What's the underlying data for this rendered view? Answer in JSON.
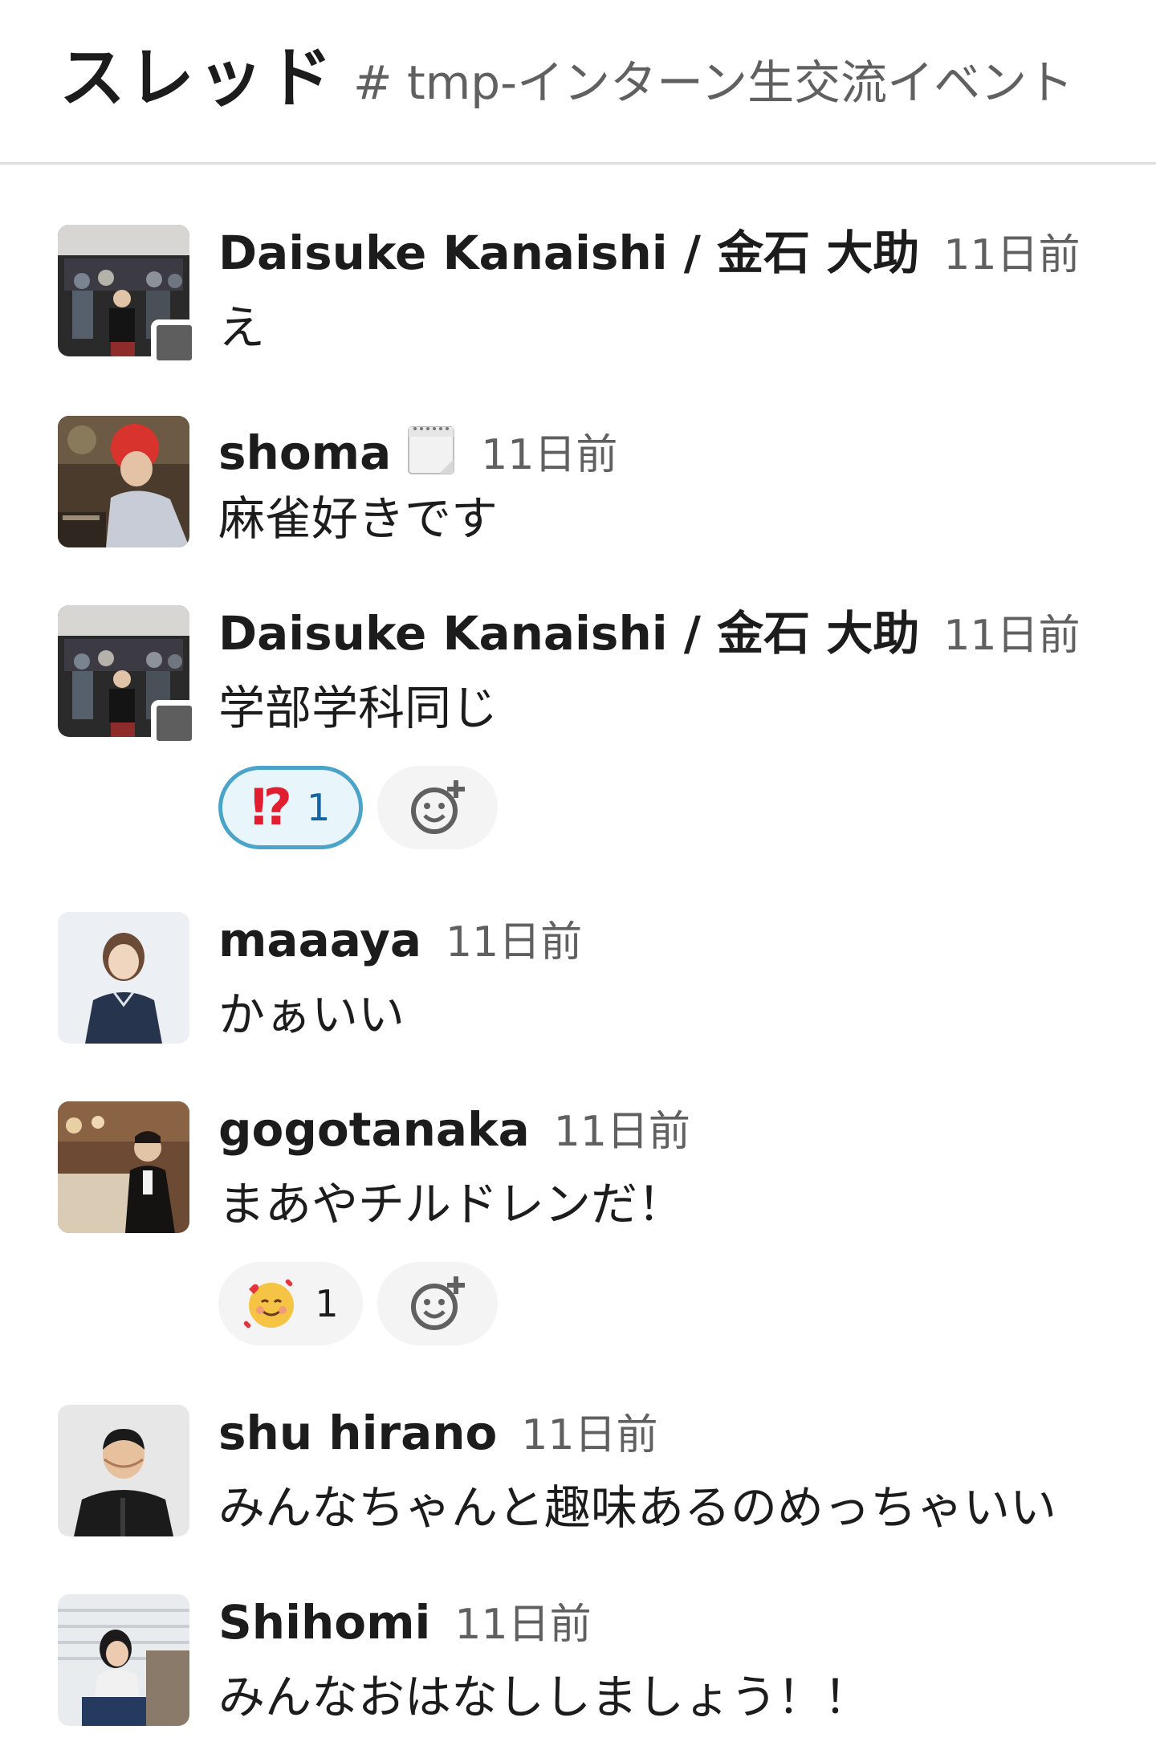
{
  "header": {
    "title": "スレッド",
    "channel": "# tmp-インターン生交流イベント"
  },
  "messages": [
    {
      "name": "Daisuke Kanaishi / 金石 大助",
      "time": "11日前",
      "text": "え"
    },
    {
      "name": "shoma",
      "status_icon": "calendar-icon",
      "time": "11日前",
      "text": "麻雀好きです"
    },
    {
      "name": "Daisuke Kanaishi / 金石 大助",
      "time": "11日前",
      "text": "学部学科同じ",
      "reactions": [
        {
          "emoji": "⁉",
          "emoji_name": "interrobang-icon",
          "count": "1"
        }
      ]
    },
    {
      "name": "maaaya",
      "time": "11日前",
      "text": "かぁいい"
    },
    {
      "name": "gogotanaka",
      "time": "11日前",
      "text": "まあやチルドレンだ！",
      "reactions": [
        {
          "emoji_name": "smiling-face-with-hearts-icon",
          "count": "1"
        }
      ]
    },
    {
      "name": "shu hirano",
      "time": "11日前",
      "text": "みんなちゃんと趣味あるのめっちゃいい"
    },
    {
      "name": "Shihomi",
      "time": "11日前",
      "text": "みんなおはなししましょう！！"
    }
  ],
  "colors": {
    "reaction_active_border": "#4aa3c8",
    "presence_away": "#5e5e5e",
    "timestamp": "#616061"
  }
}
